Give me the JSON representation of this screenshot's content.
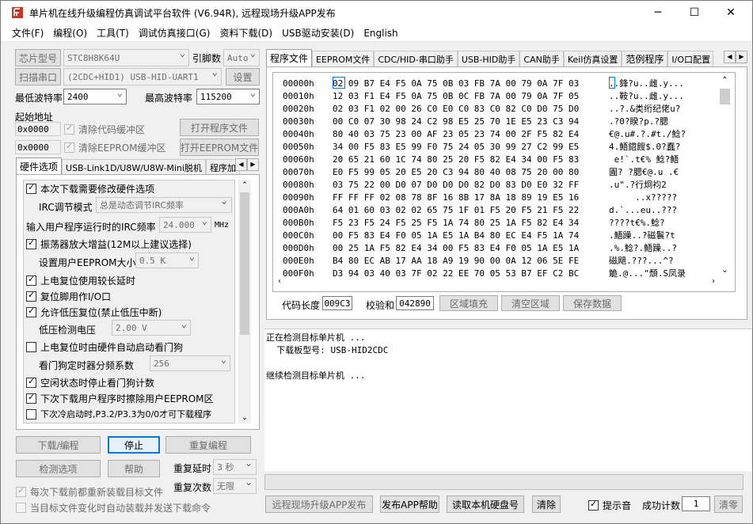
{
  "window": {
    "title": "单片机在线升级编程仿真调试平台软件 (V6.94R), 远程现场升级APP发布",
    "min": "─",
    "max": "☐",
    "close": "✕"
  },
  "menu": [
    "文件(F)",
    "编程(O)",
    "工具(T)",
    "调试仿真接口(G)",
    "资料下载(D)",
    "USB驱动安装(D)",
    "English"
  ],
  "left": {
    "chip_label": "芯片型号",
    "chip_value": "STC8H8K64U",
    "pin_label": "引脚数",
    "pin_value": "Auto",
    "scan_label": "扫描串口",
    "port_value": "(2CDC+HID1) USB-HID-UART1",
    "settings_label": "设置",
    "min_baud_label": "最低波特率",
    "min_baud_value": "2400",
    "max_baud_label": "最高波特率",
    "max_baud_value": "115200",
    "start_addr_label": "起始地址",
    "addr1": "0x0000",
    "addr2": "0x0000",
    "clear_code_label": "清除代码缓冲区",
    "clear_eeprom_label": "清除EEPROM缓冲区",
    "open_prog_label": "打开程序文件",
    "open_eeprom_label": "打开EEPROM文件",
    "tabs": [
      "硬件选项",
      "USB-Link1D/U8W/U8W-Mini脱机",
      "程序加"
    ],
    "hw": {
      "opt1": "本次下载需要修改硬件选项",
      "irc_mode_label": "IRC调节模式",
      "irc_mode_value": "总是动态调节IRC频率",
      "irc_freq_label": "输入用户程序运行时的IRC频率",
      "irc_freq_value": "24.000",
      "irc_freq_unit": "MHz",
      "opt2": "振荡器放大增益(12M以上建议选择)",
      "eeprom_size_label": "设置用户EEPROM大小",
      "eeprom_size_value": "0.5 K",
      "opt3": "上电复位使用较长延时",
      "opt4": "复位脚用作I/O口",
      "opt5": "允许低压复位(禁止低压中断)",
      "lv_label": "低压检测电压",
      "lv_value": "2.00 V",
      "opt6": "上电复位时由硬件自动启动看门狗",
      "wdt_label": "看门狗定时器分频系数",
      "wdt_value": "256",
      "opt7": "空闲状态时停止看门狗计数",
      "opt8": "下次下载用户程序时擦除用户EEPROM区",
      "opt9": "下次冷启动时,P3.2/P3.3为0/0才可下载程序"
    },
    "download_label": "下载/编程",
    "stop_label": "停止",
    "reprog_label": "重复编程",
    "detect_label": "检测选项",
    "help_label": "帮助",
    "repeat_delay_label": "重复延时",
    "repeat_delay_value": "3 秒",
    "repeat_count_label": "重复次数",
    "repeat_count_value": "无限",
    "reload_label": "每次下载前都重新装载目标文件",
    "auto_label": "当目标文件变化时自动装载并发送下载命令"
  },
  "right": {
    "tabs": [
      "程序文件",
      "EEPROM文件",
      "CDC/HID-串口助手",
      "USB-HID助手",
      "CAN助手",
      "Keil仿真设置",
      "范例程序",
      "I/O口配置"
    ],
    "hex_rows": [
      {
        "addr": "00000h",
        "bytes": "02 09 B7 E4 F5 0A 75 0B 03 FB 7A 00 79 0A 7F 03",
        "ascii": "..鋒?u..雌.y..."
      },
      {
        "addr": "00010h",
        "bytes": "12 03 F1 E4 F5 0A 75 0B 0C FB 7A 00 79 0A 7F 05",
        "ascii": "..鞍?u..雌.y..."
      },
      {
        "addr": "00020h",
        "bytes": "02 03 F1 02 00 26 C0 E0 C0 83 C0 82 C0 D0 75 D0",
        "ascii": "..?.&类绗纪佬u?"
      },
      {
        "addr": "00030h",
        "bytes": "00 C0 07 30 98 24 C2 98 E5 25 70 1E E5 23 C3 94",
        "ascii": ".?0?睽?p.?腮"
      },
      {
        "addr": "00040h",
        "bytes": "80 40 03 75 23 00 AF 23 05 23 74 00 2F F5 82 E4",
        "ascii": "€@.u#.?.#t./鯰?"
      },
      {
        "addr": "00050h",
        "bytes": "34 00 F5 83 E5 99 F0 75 24 05 30 99 27 C2 99 E5",
        "ascii": "4.鯃鍣餿$.0?蠢?"
      },
      {
        "addr": "00060h",
        "bytes": "20 65 21 60 1C 74 80 25 20 F5 82 E4 34 00 F5 83",
        "ascii": " e!`.t€% 鯰?鯃"
      },
      {
        "addr": "00070h",
        "bytes": "E0 F5 99 05 20 E5 20 C3 94 80 40 08 75 20 00 80",
        "ascii": "圊? ?腮€@.u .€"
      },
      {
        "addr": "00080h",
        "bytes": "03 75 22 00 D0 07 D0 D0 D0 82 D0 83 D0 E0 32 FF",
        "ascii": ".u\".?行炯袀2"
      },
      {
        "addr": "00090h",
        "bytes": "FF FF FF 02 08 78 8F 16 8B 17 8A 18 89 19 E5 16",
        "ascii": "     ..x?????"
      },
      {
        "addr": "000A0h",
        "bytes": "64 01 60 03 02 02 65 75 1F 01 F5 20 F5 21 F5 22",
        "ascii": "d.`...eu..???"
      },
      {
        "addr": "000B0h",
        "bytes": "F5 23 F5 24 F5 25 F5 1A 74 80 25 1A F5 82 E4 34",
        "ascii": "????t€%.鯰?"
      },
      {
        "addr": "000C0h",
        "bytes": "00 F5 83 E4 F0 05 1A E5 1A B4 80 EC E4 F5 1A 74",
        "ascii": ".鯃躁..?磁鬟?t"
      },
      {
        "addr": "000D0h",
        "bytes": "00 25 1A F5 82 E4 34 00 F5 83 E4 F0 05 1A E5 1A",
        "ascii": ".%.鯰?.鯃躁..?"
      },
      {
        "addr": "000E0h",
        "bytes": "B4 80 EC AB 17 AA 18 A9 19 90 00 0A 12 06 5E FE",
        "ascii": "磁飓.???...^?"
      },
      {
        "addr": "000F0h",
        "bytes": "D3 94 03 40 03 7F 02 22 EE 70 05 53 B7 EF C2 BC",
        "ascii": "觤.@...\"頹.S凤录"
      }
    ],
    "code_len_label": "代码长度",
    "code_len_value": "009C3",
    "checksum_label": "校验和",
    "checksum_value": "042890",
    "fill_label": "区域填充",
    "clear_area_label": "清空区域",
    "save_label": "保存数据",
    "log_lines": [
      "正在检测目标单片机 ...",
      "  下载板型号: USB-HID2CDC",
      "",
      "继续检测目标单片机 ..."
    ],
    "publish_label": "远程现场升级APP发布",
    "publish_help_label": "发布APP帮助",
    "read_disk_label": "读取本机硬盘号",
    "clear_label": "清除",
    "beep_label": "提示音",
    "success_label": "成功计数",
    "success_value": "1",
    "reset_label": "清零"
  }
}
